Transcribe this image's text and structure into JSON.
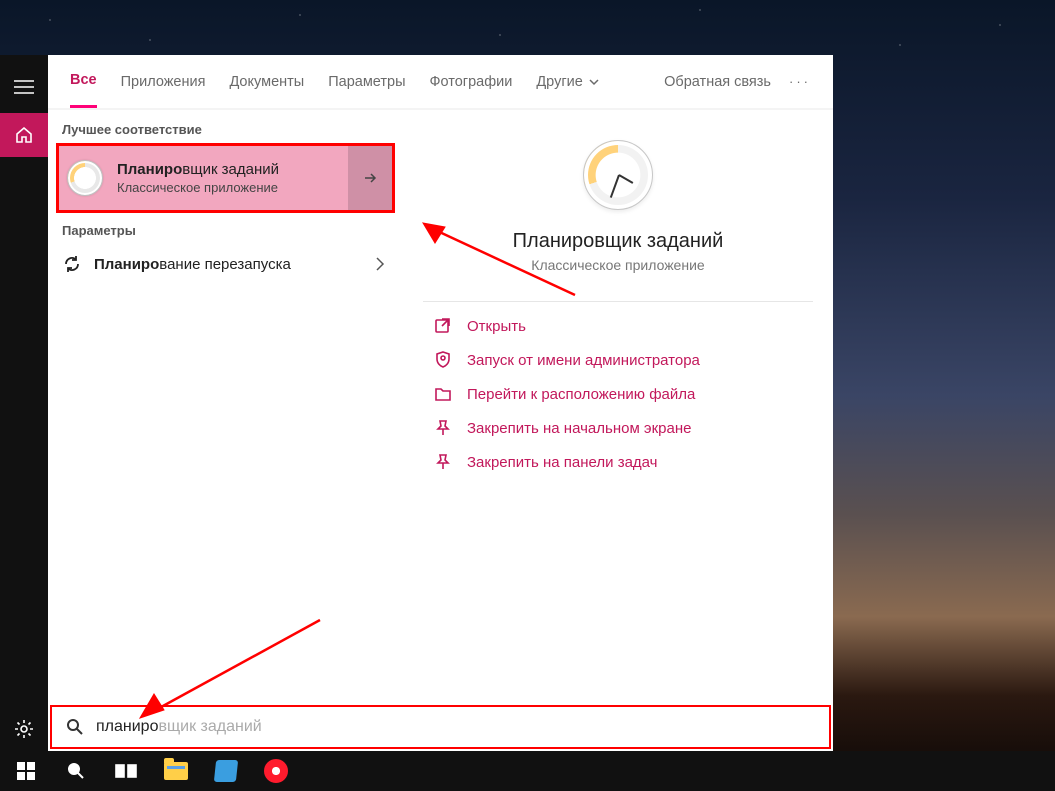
{
  "tabs": {
    "all": "Все",
    "apps": "Приложения",
    "docs": "Документы",
    "params": "Параметры",
    "photos": "Фотографии",
    "more": "Другие"
  },
  "feedback": "Обратная связь",
  "sections": {
    "best_match": "Лучшее соответствие",
    "params": "Параметры"
  },
  "best": {
    "title_bold": "Планиро",
    "title_rest": "вщик заданий",
    "subtitle": "Классическое приложение"
  },
  "param_item": {
    "bold": "Планиро",
    "rest": "вание перезапуска"
  },
  "details": {
    "title": "Планировщик заданий",
    "subtitle": "Классическое приложение"
  },
  "actions": {
    "open": "Открыть",
    "run_admin": "Запуск от имени администратора",
    "goto_location": "Перейти к расположению файла",
    "pin_start": "Закрепить на начальном экране",
    "pin_taskbar": "Закрепить на панели задач"
  },
  "search": {
    "typed": "планиро",
    "ghost": "вщик заданий"
  }
}
